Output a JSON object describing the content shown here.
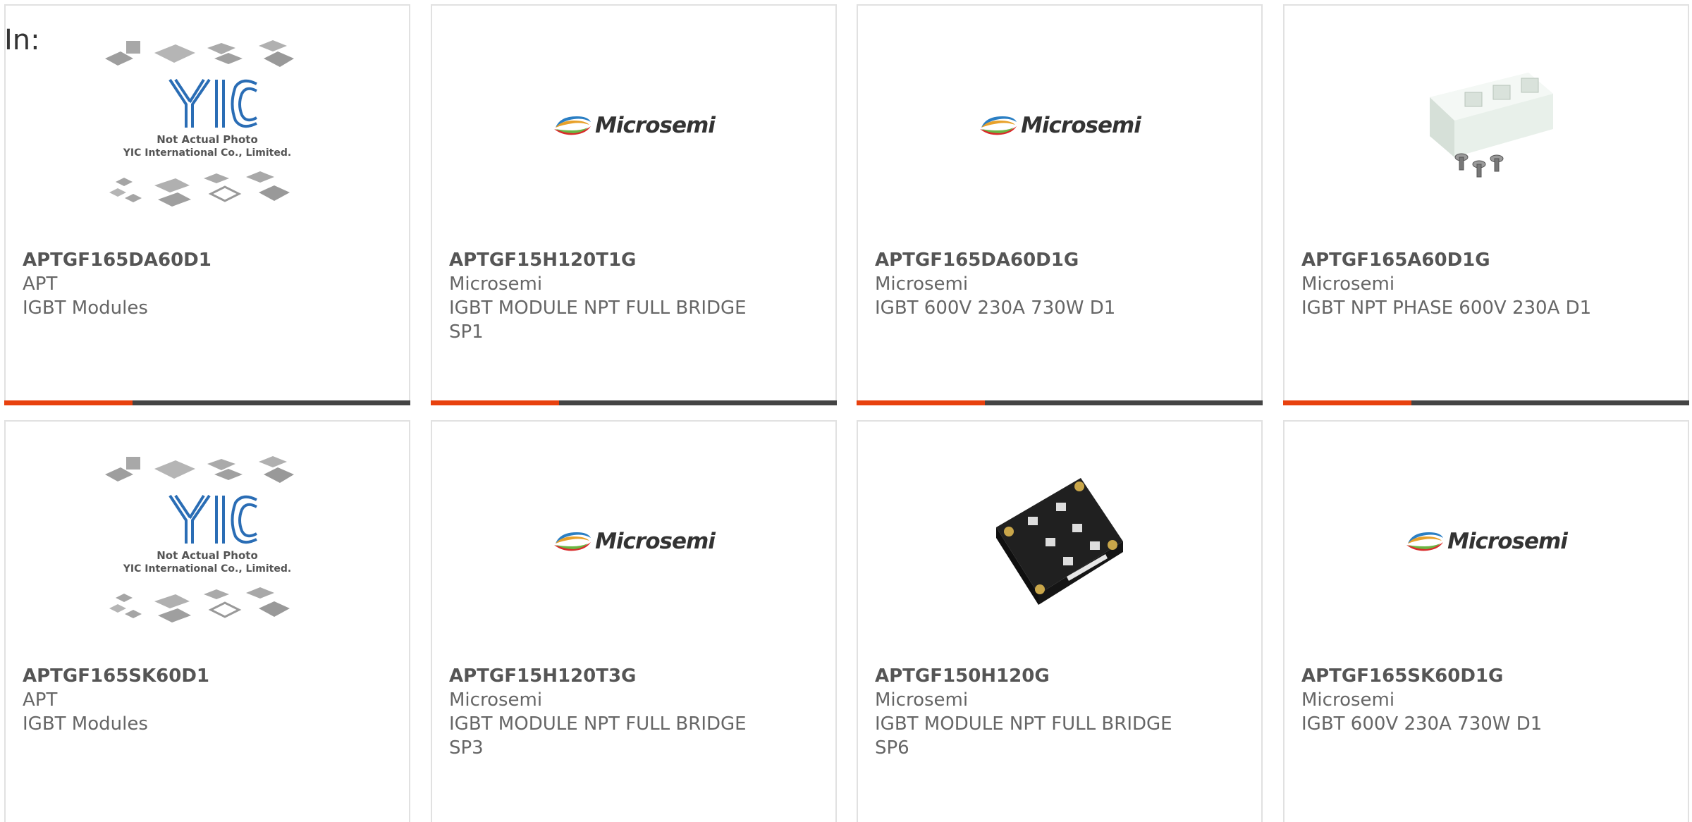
{
  "filter": {
    "label": "In:"
  },
  "logo_texts": {
    "yic_brand": "YIC",
    "not_actual_photo": "Not Actual Photo",
    "yic_company": "YIC International Co., Limited.",
    "microsemi": "Microsemi"
  },
  "colors": {
    "accent": "#e8410e",
    "bar": "#444444",
    "border": "#e1e1e1",
    "text": "#666666"
  },
  "products": [
    {
      "part": "APTGF165DA60D1",
      "mfr": "APT",
      "desc": "IGBT Modules",
      "image": "yic-placeholder"
    },
    {
      "part": "APTGF15H120T1G",
      "mfr": "Microsemi",
      "desc": "IGBT MODULE NPT FULL BRIDGE SP1",
      "image": "microsemi-logo"
    },
    {
      "part": "APTGF165DA60D1G",
      "mfr": "Microsemi",
      "desc": "IGBT 600V 230A 730W D1",
      "image": "microsemi-logo"
    },
    {
      "part": "APTGF165A60D1G",
      "mfr": "Microsemi",
      "desc": "IGBT NPT PHASE 600V 230A D1",
      "image": "igbt-module-white-photo"
    },
    {
      "part": "APTGF165SK60D1",
      "mfr": "APT",
      "desc": "IGBT Modules",
      "image": "yic-placeholder"
    },
    {
      "part": "APTGF15H120T3G",
      "mfr": "Microsemi",
      "desc": "IGBT MODULE NPT FULL BRIDGE SP3",
      "image": "microsemi-logo"
    },
    {
      "part": "APTGF150H120G",
      "mfr": "Microsemi",
      "desc": "IGBT MODULE NPT FULL BRIDGE SP6",
      "image": "igbt-module-black-photo"
    },
    {
      "part": "APTGF165SK60D1G",
      "mfr": "Microsemi",
      "desc": "IGBT 600V 230A 730W D1",
      "image": "microsemi-logo"
    }
  ]
}
